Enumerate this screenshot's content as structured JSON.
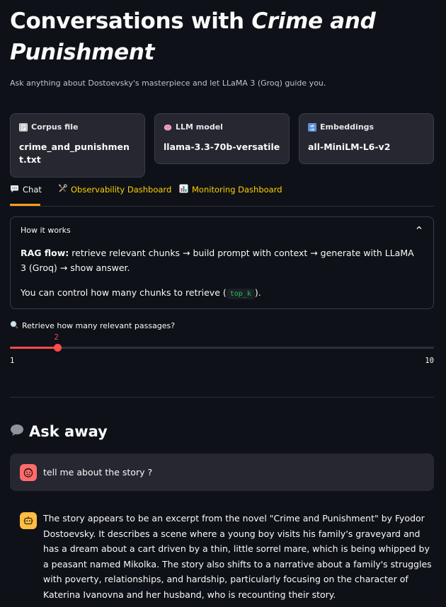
{
  "header": {
    "title_plain": "Conversations with ",
    "title_emph": "Crime and Punishment",
    "subtitle": "Ask anything about Dostoevsky's masterpiece and let LLaMA 3 (Groq) guide you."
  },
  "cards": [
    {
      "icon": "page-icon",
      "label": "Corpus file",
      "value": "crime_and_punishment.txt"
    },
    {
      "icon": "brain-icon",
      "label": "LLM model",
      "value": "llama-3.3-70b-versatile"
    },
    {
      "icon": "abcd-icon",
      "label": "Embeddings",
      "value": "all-MiniLM-L6-v2"
    }
  ],
  "tabs": [
    {
      "icon": "speech-bubble-icon",
      "label": "Chat",
      "active": true
    },
    {
      "icon": "tools-icon",
      "label": "Observability Dashboard",
      "active": false
    },
    {
      "icon": "bar-chart-icon",
      "label": "Monitoring Dashboard",
      "active": false
    }
  ],
  "expander": {
    "title": "How it works",
    "flow_label": "RAG flow:",
    "flow_text": " retrieve relevant chunks → build prompt with context → generate with LLaMA 3 (Groq) → show answer.",
    "control_pre": "You can control how many chunks to retrieve (",
    "control_code": "top_k",
    "control_post": ")."
  },
  "slider": {
    "icon": "magnifier-icon",
    "label": "Retrieve how many relevant passages?",
    "value": 2,
    "value_label": "2",
    "min": 1,
    "max": 10,
    "min_label": "1",
    "max_label": "10"
  },
  "chat": {
    "heading_icon": "speech-balloon-icon",
    "heading": "Ask away",
    "user_message": "tell me about the story ?",
    "assistant_message": "The story appears to be an excerpt from the novel \"Crime and Punishment\" by Fyodor Dostoevsky. It describes a scene where a young boy visits his family's graveyard and has a dream about a cart driven by a thin, little sorrel mare, which is being whipped by a peasant named Mikolka. The story also shifts to a narrative about a family's struggles with poverty, relationships, and hardship, particularly focusing on the character of Katerina Ivanovna and her husband, who is recounting their story."
  },
  "colors": {
    "background": "#0e1117",
    "accent": "#ff4b4b",
    "tab_accent": "#ff9f1c",
    "card_bg": "#262730"
  }
}
